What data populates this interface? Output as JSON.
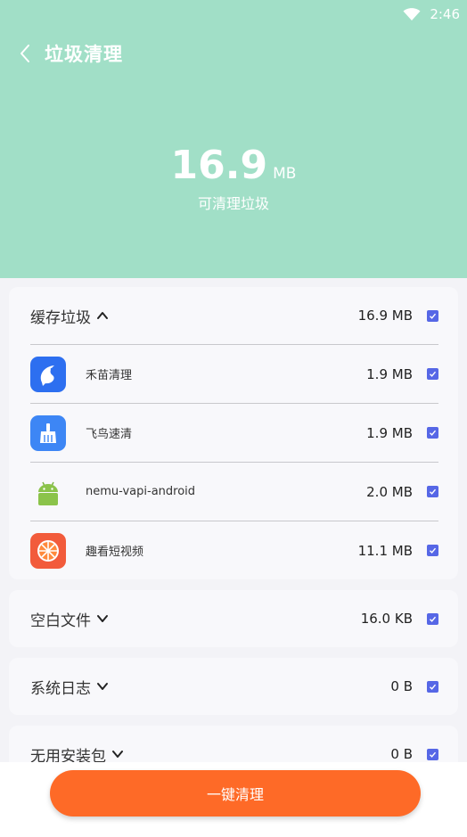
{
  "status_bar": {
    "time": "2:46"
  },
  "header": {
    "title": "垃圾清理"
  },
  "summary": {
    "value": "16.9",
    "unit": "MB",
    "caption": "可清理垃圾"
  },
  "sections": [
    {
      "title": "缓存垃圾",
      "expanded": true,
      "size": "16.9 MB",
      "items": [
        {
          "name": "禾苗清理",
          "size": "1.9 MB",
          "icon": "fish-icon"
        },
        {
          "name": "飞鸟速清",
          "size": "1.9 MB",
          "icon": "broom-icon"
        },
        {
          "name": "nemu-vapi-android",
          "size": "2.0 MB",
          "icon": "android-icon"
        },
        {
          "name": "趣看短视频",
          "size": "11.1 MB",
          "icon": "orange-slice-icon"
        }
      ]
    },
    {
      "title": "空白文件",
      "expanded": false,
      "size": "16.0 KB"
    },
    {
      "title": "系统日志",
      "expanded": false,
      "size": "0 B"
    },
    {
      "title": "无用安装包",
      "expanded": false,
      "size": "0 B"
    }
  ],
  "action": {
    "clean_label": "一键清理"
  },
  "colors": {
    "header_bg": "#a1dfc7",
    "accent": "#fe6a27",
    "checkbox": "#5667e6"
  }
}
